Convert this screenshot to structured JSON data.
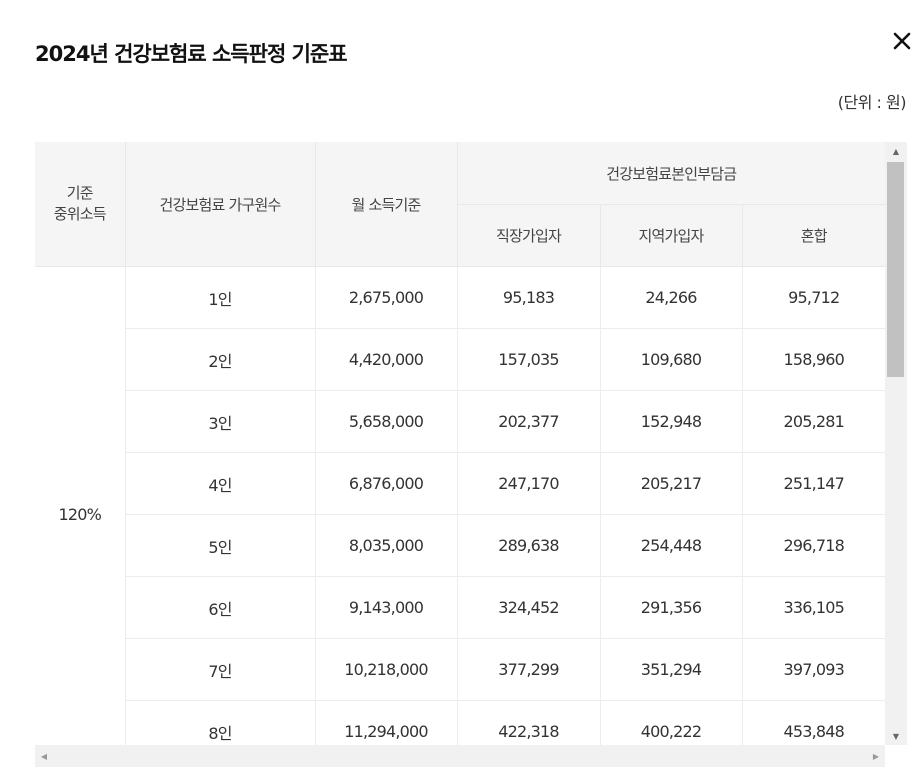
{
  "modal": {
    "title": "2024년 건강보험료 소득판정 기준표",
    "unit_label": "(단위 : 원)"
  },
  "table": {
    "headers": {
      "median_line1": "기준",
      "median_line2": "중위소득",
      "household": "건강보험료 가구원수",
      "monthly_income": "월 소득기준",
      "premium_group": "건강보험료본인부담금",
      "employee": "직장가입자",
      "regional": "지역가입자",
      "mixed": "혼합"
    },
    "median_value": "120%",
    "rows": [
      {
        "household": "1인",
        "income": "2,675,000",
        "employee": "95,183",
        "regional": "24,266",
        "mixed": "95,712"
      },
      {
        "household": "2인",
        "income": "4,420,000",
        "employee": "157,035",
        "regional": "109,680",
        "mixed": "158,960"
      },
      {
        "household": "3인",
        "income": "5,658,000",
        "employee": "202,377",
        "regional": "152,948",
        "mixed": "205,281"
      },
      {
        "household": "4인",
        "income": "6,876,000",
        "employee": "247,170",
        "regional": "205,217",
        "mixed": "251,147"
      },
      {
        "household": "5인",
        "income": "8,035,000",
        "employee": "289,638",
        "regional": "254,448",
        "mixed": "296,718"
      },
      {
        "household": "6인",
        "income": "9,143,000",
        "employee": "324,452",
        "regional": "291,356",
        "mixed": "336,105"
      },
      {
        "household": "7인",
        "income": "10,218,000",
        "employee": "377,299",
        "regional": "351,294",
        "mixed": "397,093"
      },
      {
        "household": "8인",
        "income": "11,294,000",
        "employee": "422,318",
        "regional": "400,222",
        "mixed": "453,848"
      }
    ]
  },
  "icons": {
    "close": "close-icon",
    "scroll_up": "▲",
    "scroll_down": "▼",
    "scroll_left": "◀",
    "scroll_right": "▶"
  }
}
